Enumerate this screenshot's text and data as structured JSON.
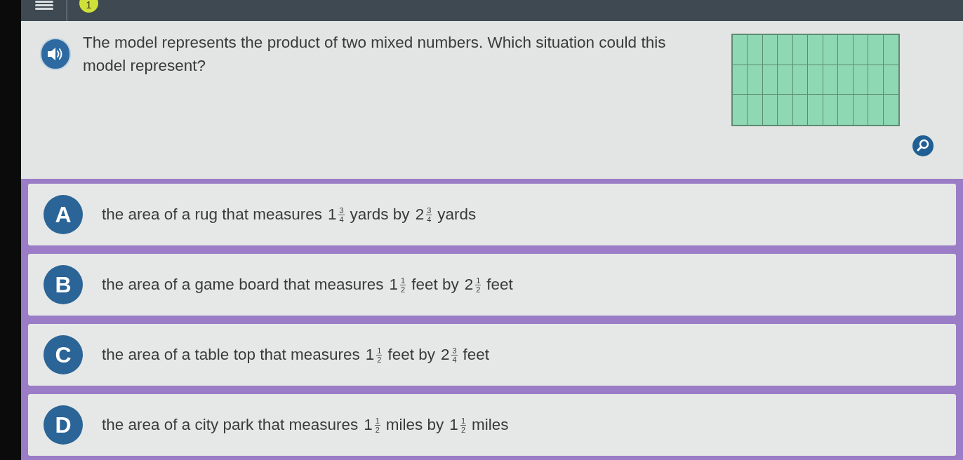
{
  "top_bar": {
    "question_number": "1"
  },
  "question": {
    "text": "The model represents the product of two mixed numbers. Which situation could this model represent?"
  },
  "choices": [
    {
      "letter": "A",
      "parts": [
        {
          "kind": "text",
          "text": "the area of a rug that measures"
        },
        {
          "kind": "mixed",
          "whole": "1",
          "numerator": "3",
          "denominator": "4"
        },
        {
          "kind": "text",
          "text": "yards by"
        },
        {
          "kind": "mixed",
          "whole": "2",
          "numerator": "3",
          "denominator": "4"
        },
        {
          "kind": "text",
          "text": "yards"
        }
      ]
    },
    {
      "letter": "B",
      "parts": [
        {
          "kind": "text",
          "text": "the area of a game board that measures"
        },
        {
          "kind": "mixed",
          "whole": "1",
          "numerator": "1",
          "denominator": "2"
        },
        {
          "kind": "text",
          "text": "feet by"
        },
        {
          "kind": "mixed",
          "whole": "2",
          "numerator": "1",
          "denominator": "2"
        },
        {
          "kind": "text",
          "text": "feet"
        }
      ]
    },
    {
      "letter": "C",
      "parts": [
        {
          "kind": "text",
          "text": "the area of a table top that measures"
        },
        {
          "kind": "mixed",
          "whole": "1",
          "numerator": "1",
          "denominator": "2"
        },
        {
          "kind": "text",
          "text": "feet by"
        },
        {
          "kind": "mixed",
          "whole": "2",
          "numerator": "3",
          "denominator": "4"
        },
        {
          "kind": "text",
          "text": "feet"
        }
      ]
    },
    {
      "letter": "D",
      "parts": [
        {
          "kind": "text",
          "text": "the area of a city park that measures"
        },
        {
          "kind": "mixed",
          "whole": "1",
          "numerator": "1",
          "denominator": "2"
        },
        {
          "kind": "text",
          "text": "miles by"
        },
        {
          "kind": "mixed",
          "whole": "1",
          "numerator": "1",
          "denominator": "2"
        },
        {
          "kind": "text",
          "text": "miles"
        }
      ]
    }
  ]
}
